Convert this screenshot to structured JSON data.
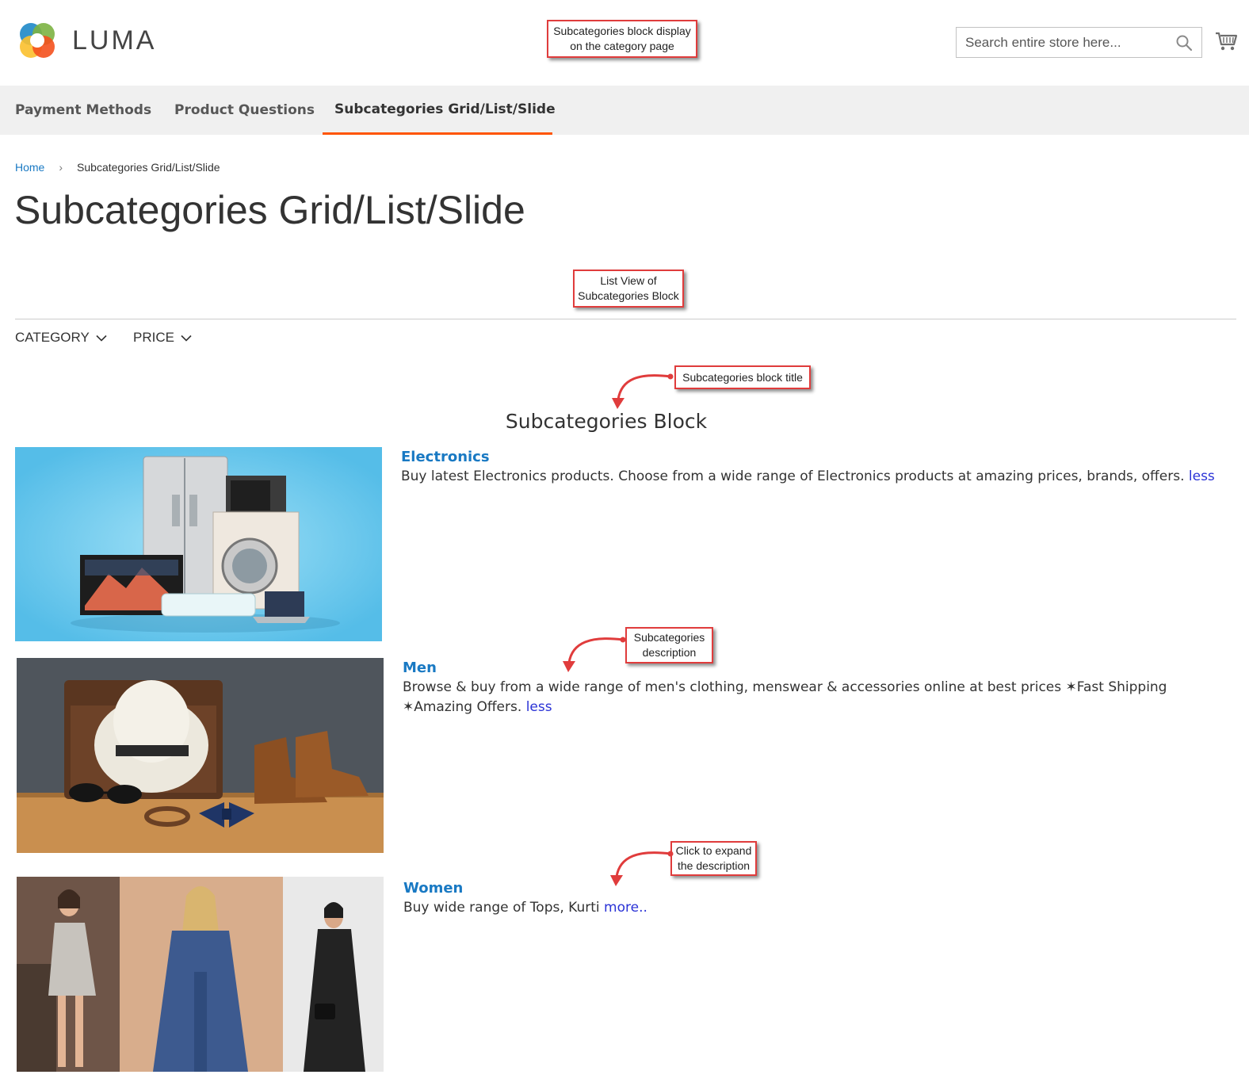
{
  "header": {
    "logo_text": "LUMA",
    "search_placeholder": "Search entire store here...",
    "colors": {
      "accent": "#ff5501",
      "link": "#1979c3"
    }
  },
  "nav": {
    "items": [
      {
        "label": "Payment Methods"
      },
      {
        "label": "Product Questions"
      },
      {
        "label": "Subcategories Grid/List/Slide"
      }
    ]
  },
  "breadcrumb": {
    "home": "Home",
    "current": "Subcategories Grid/List/Slide"
  },
  "page_title": "Subcategories Grid/List/Slide",
  "filters": [
    {
      "label": "CATEGORY"
    },
    {
      "label": "PRICE"
    }
  ],
  "block_title": "Subcategories Block",
  "subcategories": [
    {
      "name": "Electronics",
      "description": "Buy latest Electronics products. Choose from a wide range of Electronics products at amazing prices, brands, offers.",
      "toggle": "less"
    },
    {
      "name": "Men",
      "description": "Browse & buy from a wide range of men's clothing, menswear & accessories online at best prices ✶Fast Shipping ✶Amazing Offers.",
      "toggle": "less"
    },
    {
      "name": "Women",
      "description": "Buy wide range of Tops, Kurti",
      "toggle": "more.."
    }
  ],
  "annotations": {
    "top_line1": "Subcategories block display",
    "top_line2": "on the category page",
    "list_line1": "List View of",
    "list_line2": "Subcategories Block",
    "title_label": "Subcategories block title",
    "desc_line1": "Subcategories",
    "desc_line2": "description",
    "expand_line1": "Click to expand",
    "expand_line2": "the description"
  }
}
